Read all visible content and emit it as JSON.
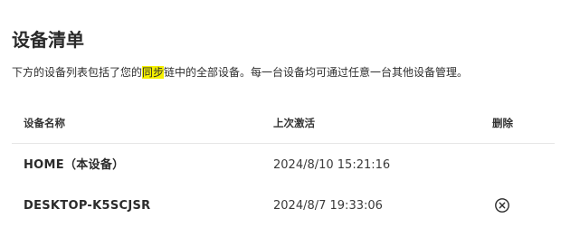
{
  "page": {
    "title": "设备清单",
    "description_before": "下方的设备列表包括了您的",
    "description_highlight": "同步",
    "description_after": "链中的全部设备。每一台设备均可通过任意一台其他设备管理。"
  },
  "table": {
    "headers": {
      "name": "设备名称",
      "last_active": "上次激活",
      "delete": "删除"
    },
    "rows": [
      {
        "name": "HOME（本设备）",
        "last_active": "2024/8/10 15:21:16",
        "deletable": false
      },
      {
        "name": "DESKTOP-K5SCJSR",
        "last_active": "2024/8/7 19:33:06",
        "deletable": true
      }
    ]
  },
  "icons": {
    "delete": "close-circle-icon"
  },
  "colors": {
    "highlight": "#f5f000",
    "divider": "#e6e6e6"
  }
}
